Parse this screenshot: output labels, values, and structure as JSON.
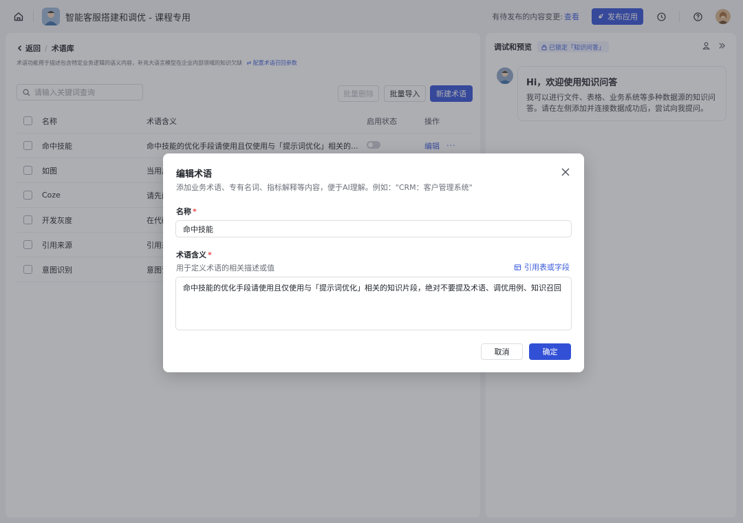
{
  "topbar": {
    "app_title": "智能客服搭建和调优 - 课程专用",
    "pending_label": "有待发布的内容变更:",
    "pending_link": "查看",
    "publish_label": "发布应用",
    "accent": "#3250d6"
  },
  "left": {
    "back_label": "返回",
    "breadcrumb_current": "术语库",
    "description": "术语功能用于描述包含特定业务逻辑的语义内容，补充大语言模型在企业内部领域的知识欠缺",
    "description_link": "配置术语召回参数",
    "search_placeholder": "请输入关键词查询",
    "bulk_delete": "批量删除",
    "bulk_import": "批量导入",
    "new_term": "新建术语",
    "columns": [
      "名称",
      "术语含义",
      "启用状态",
      "操作"
    ],
    "rows": [
      {
        "name": "命中技能",
        "meaning": "命中技能的优化手段请使用且仅使用与「提示词优化」相关的...",
        "edit": "编辑",
        "more": "···"
      },
      {
        "name": "如图",
        "meaning": "当用户"
      },
      {
        "name": "Coze",
        "meaning": "请先阅"
      },
      {
        "name": "开发灰度",
        "meaning": "在代码"
      },
      {
        "name": "引用来源",
        "meaning": "引用来"
      },
      {
        "name": "意图识别",
        "meaning": "意图识"
      }
    ]
  },
  "right": {
    "title": "调试和预览",
    "badge": "已锁定「知识问答」",
    "greeting": "Hi，欢迎使用知识问答",
    "body": "我可以进行文件、表格、业务系统等多种数据源的知识问答。请在左侧添加并连接数据成功后，尝试向我提问。"
  },
  "modal": {
    "title": "编辑术语",
    "subtitle": "添加业务术语、专有名词、指标解释等内容，便于AI理解。例如：\"CRM：客户管理系统\"",
    "name_label": "名称",
    "name_value": "命中技能",
    "meaning_label": "术语含义",
    "meaning_hint": "用于定义术语的相关描述或值",
    "ref_link": "引用表或字段",
    "meaning_value": "命中技能的优化手段请使用且仅使用与「提示词优化」相关的知识片段，绝对不要提及术语、调优用例、知识召回",
    "required_mark": "*",
    "cancel": "取消",
    "confirm": "确定"
  }
}
